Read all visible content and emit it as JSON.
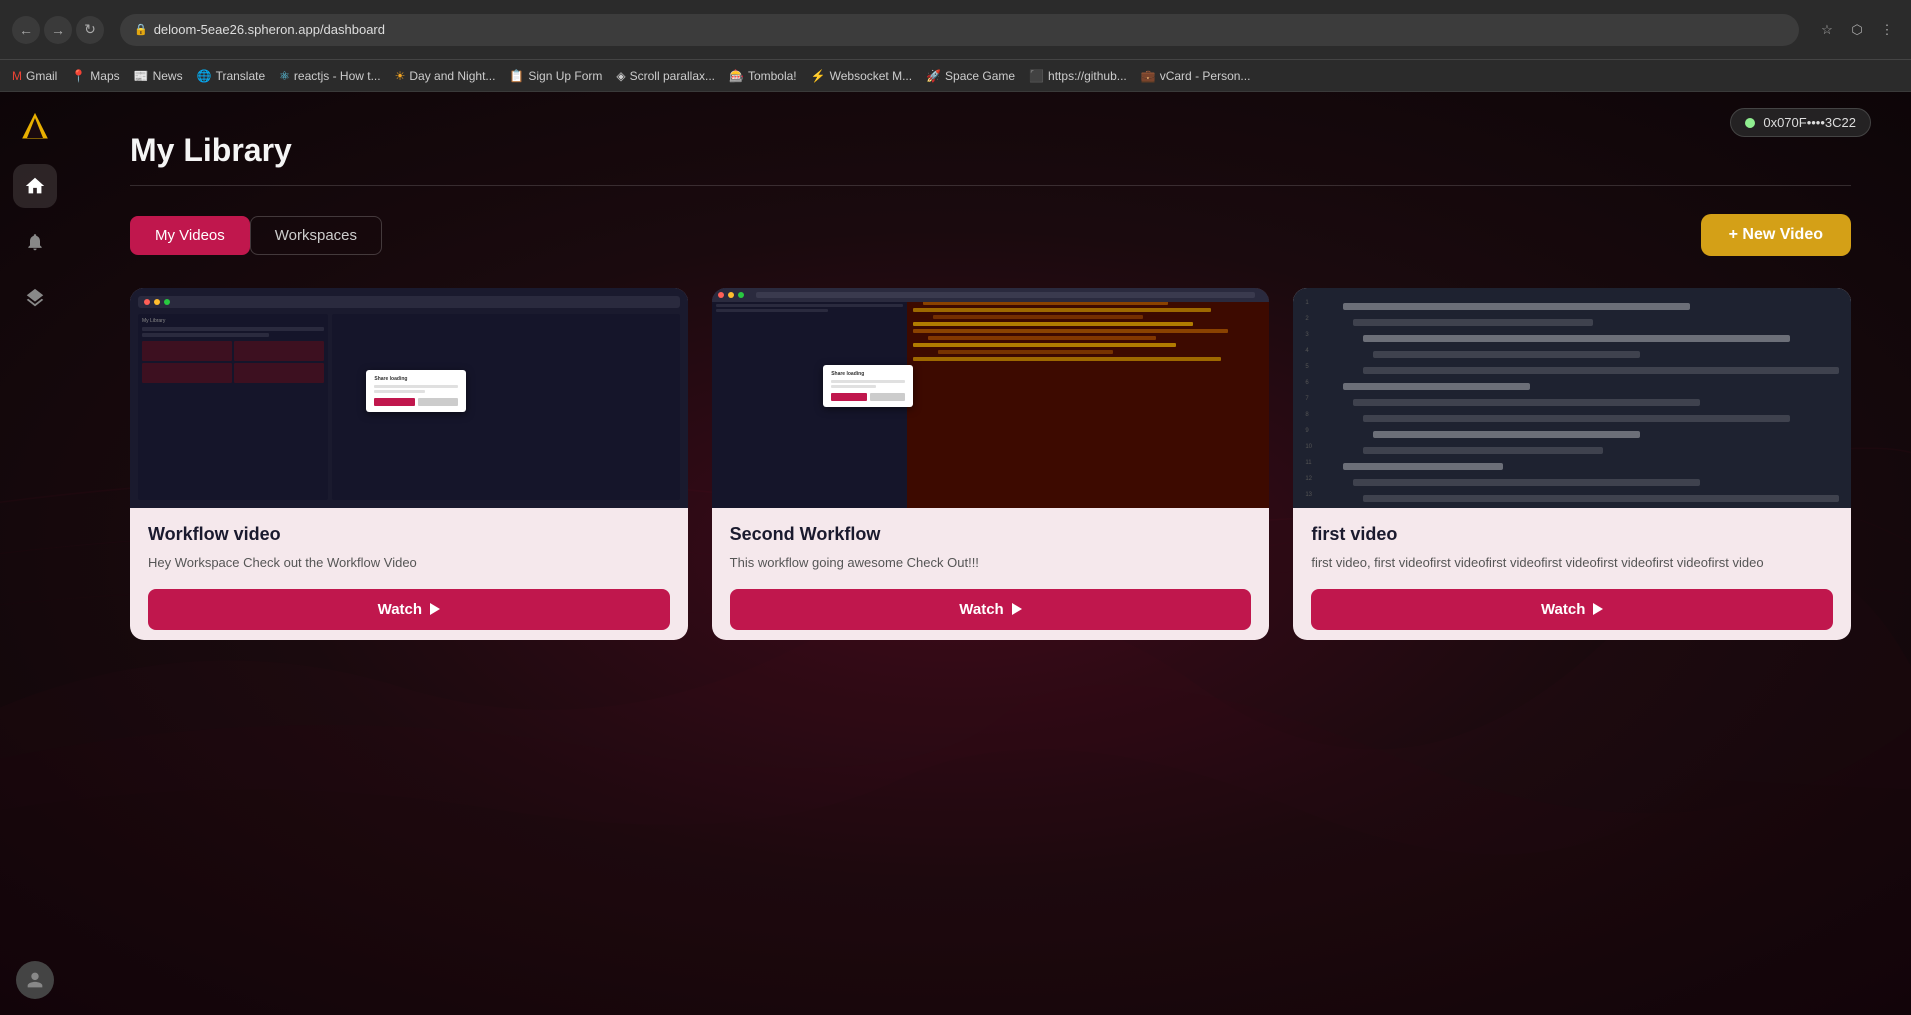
{
  "browser": {
    "url": "deloom-5eae26.spheron.app/dashboard",
    "back_btn": "←",
    "forward_btn": "→",
    "refresh_btn": "↻"
  },
  "bookmarks": [
    {
      "label": "Gmail",
      "color": "#ea4335"
    },
    {
      "label": "Maps",
      "color": "#34a853"
    },
    {
      "label": "News",
      "color": "#4285f4"
    },
    {
      "label": "Translate",
      "color": "#4285f4"
    },
    {
      "label": "reactjs - How t...",
      "color": "#61dafb"
    },
    {
      "label": "Day and Night...",
      "color": "#f5a623"
    },
    {
      "label": "Sign Up Form",
      "color": "#555"
    },
    {
      "label": "Scroll parallax...",
      "color": "#555"
    },
    {
      "label": "Tombola!",
      "color": "#ff6b35"
    },
    {
      "label": "Websocket M...",
      "color": "#555"
    },
    {
      "label": "Space Game",
      "color": "#555"
    },
    {
      "label": "https://github...",
      "color": "#333"
    },
    {
      "label": "vCard - Person...",
      "color": "#4285f4"
    }
  ],
  "header": {
    "wallet_address": "0x070F••••3C22",
    "wallet_status": "connected"
  },
  "sidebar": {
    "items": [
      {
        "id": "home",
        "icon": "⌂",
        "active": true
      },
      {
        "id": "notifications",
        "icon": "🔔",
        "active": false
      },
      {
        "id": "layers",
        "icon": "⬡",
        "active": false
      }
    ]
  },
  "page": {
    "title": "My Library",
    "tabs": [
      {
        "id": "my-videos",
        "label": "My Videos",
        "active": true
      },
      {
        "id": "workspaces",
        "label": "Workspaces",
        "active": false
      }
    ],
    "new_video_btn": "+ New Video",
    "cards": [
      {
        "id": "card-1",
        "title": "Workflow video",
        "description": "Hey Workspace Check out the Workflow Video",
        "watch_label": "Watch",
        "thumb_type": "workflow-1"
      },
      {
        "id": "card-2",
        "title": "Second Workflow",
        "description": "This workflow going awesome Check Out!!!",
        "watch_label": "Watch",
        "thumb_type": "workflow-2"
      },
      {
        "id": "card-3",
        "title": "first video",
        "description": "first video, first videofirst videofirst videofirst videofirst videofirst videofirst video",
        "watch_label": "Watch",
        "thumb_type": "code-editor"
      }
    ]
  }
}
